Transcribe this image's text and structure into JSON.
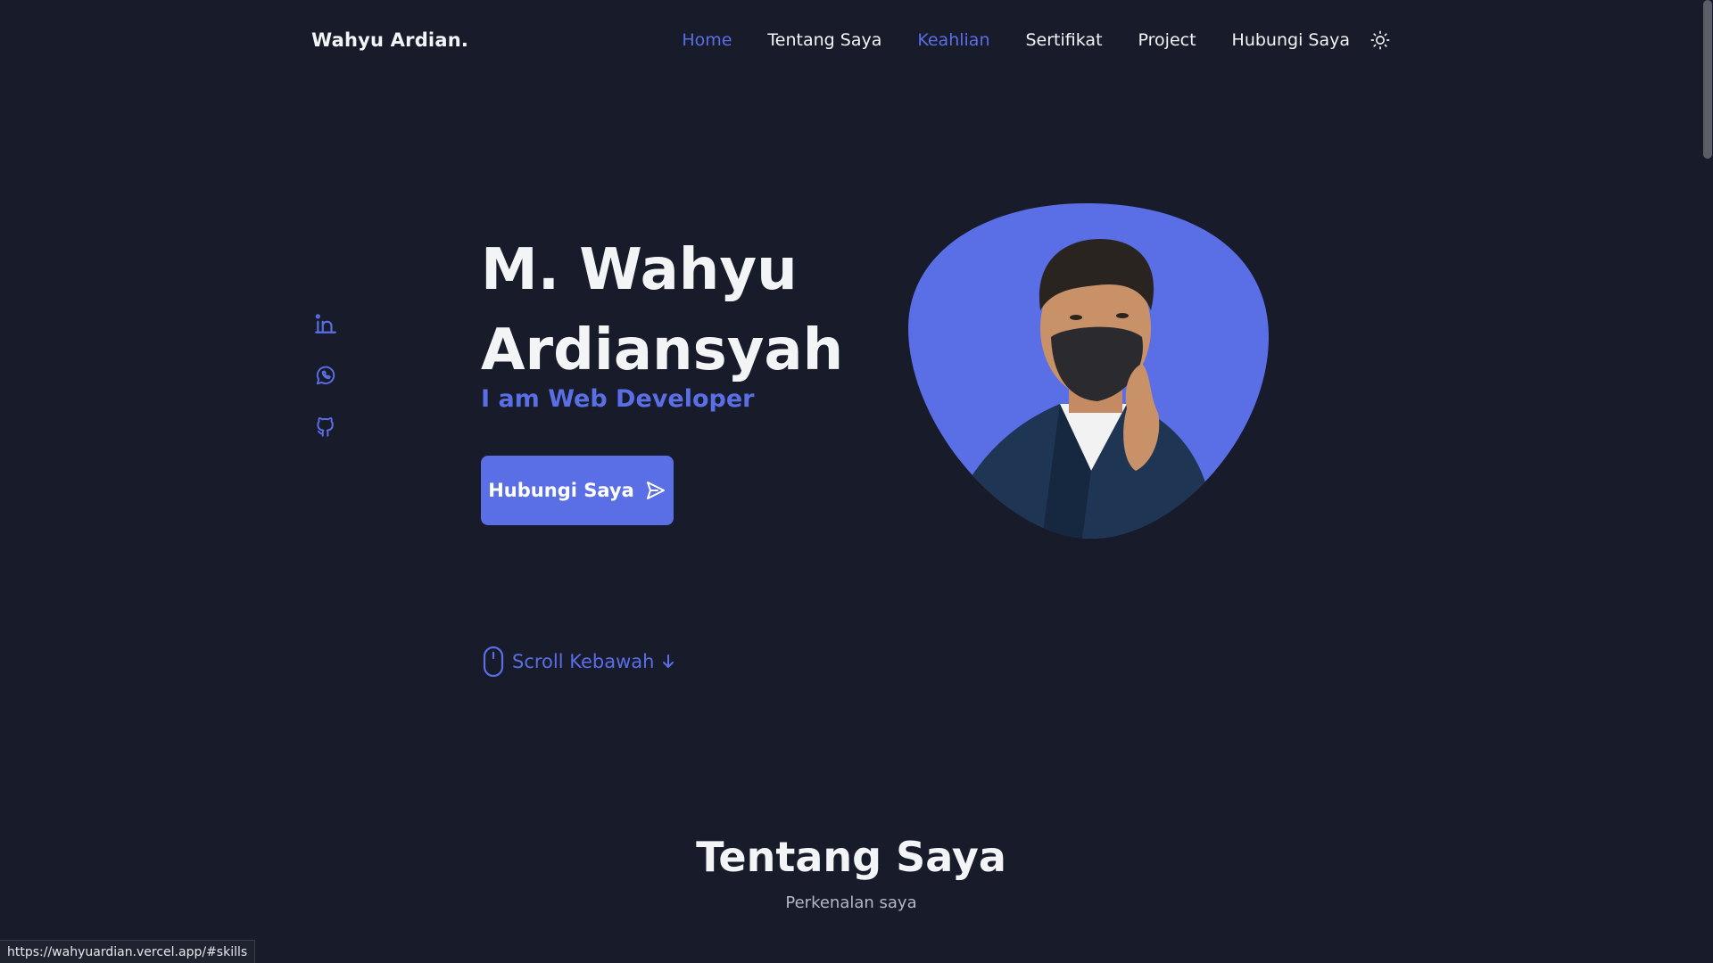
{
  "header": {
    "logo": "Wahyu Ardian.",
    "nav": [
      {
        "label": "Home",
        "active": true
      },
      {
        "label": "Tentang Saya",
        "active": false
      },
      {
        "label": "Keahlian",
        "active": true
      },
      {
        "label": "Sertifikat",
        "active": false
      },
      {
        "label": "Project",
        "active": false
      },
      {
        "label": "Hubungi Saya",
        "active": false
      }
    ],
    "theme_toggle_icon": "sun-icon"
  },
  "social": [
    {
      "icon": "linkedin-icon"
    },
    {
      "icon": "whatsapp-icon"
    },
    {
      "icon": "github-icon"
    }
  ],
  "hero": {
    "name_line1": "M. Wahyu",
    "name_line2": "Ardiansyah",
    "subtitle": "I am Web Developer",
    "cta_label": "Hubungi Saya",
    "cta_icon": "send-icon",
    "image_alt": "profile-photo"
  },
  "scroll": {
    "label": "Scroll Kebawah",
    "icon": "mouse-icon"
  },
  "about": {
    "title": "Tentang Saya",
    "subtitle": "Perkenalan saya"
  },
  "status_bar": {
    "url": "https://wahyuardian.vercel.app/#skills"
  },
  "colors": {
    "background": "#171b2a",
    "accent": "#5a6ee6",
    "text": "#f3f4f6",
    "muted": "#b4b8c4"
  }
}
